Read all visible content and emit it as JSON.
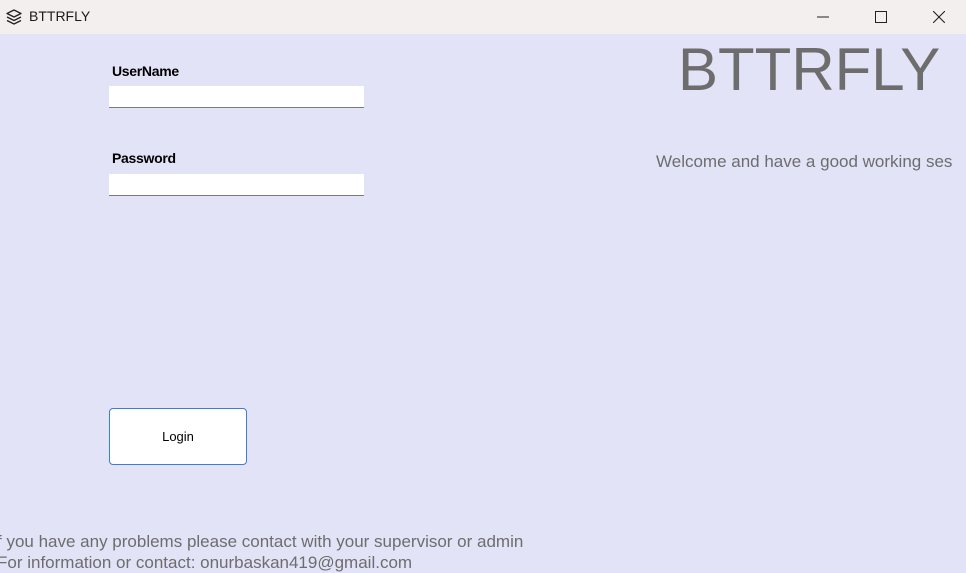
{
  "window": {
    "title": "BTTRFLY",
    "controls": [
      "minimize",
      "maximize",
      "close"
    ]
  },
  "form": {
    "username_label": "UserName",
    "username_value": "",
    "password_label": "Password",
    "password_value": "",
    "login_label": "Login"
  },
  "brand": {
    "title": "BTTRFLY",
    "welcome": "Welcome and have a good working ses"
  },
  "footer": {
    "line1": "f you have any problems please contact with your supervisor or admin",
    "line2": "For information or contact: onurbaskan419@gmail.com"
  },
  "colors": {
    "background": "#e3e3f8",
    "titlebar": "#f3efef",
    "muted_text": "#6d6d6d",
    "button_border": "#3b7fd4"
  },
  "icons": {
    "app": "layers-icon",
    "minimize": "minimize-icon",
    "maximize": "maximize-icon",
    "close": "close-icon"
  }
}
